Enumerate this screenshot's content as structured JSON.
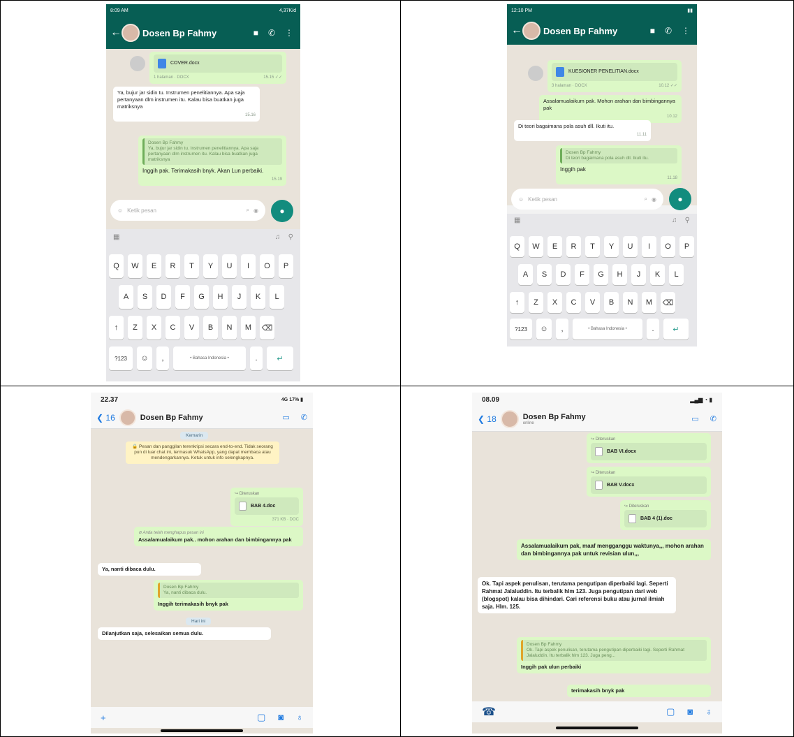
{
  "panel1": {
    "status_time": "8:09 AM",
    "status_right": "4,37K/d",
    "contact": "Dosen Bp Fahmy",
    "doc_name": "COVER.docx",
    "doc_meta": "1 halaman · DOCX",
    "doc_time": "15.15",
    "msg_in": "Ya, bujur jar sidin tu. Instrumen penelitiannya. Apa saja pertanyaan dlm instrumen itu. Kalau bisa buatkan juga matriksnya",
    "msg_in_time": "15.16",
    "quote_name": "Dosen Bp Fahmy",
    "quote_text": "Ya, bujur jar sidin tu. Instrumen penelitiannya. Apa saja pertanyaan dlm instrumen itu. Kalau bisa buatkan juga matriksnya",
    "reply": "Inggih pak. Terimakasih bnyk. Akan Lun perbaiki.",
    "reply_time": "15.19",
    "input_placeholder": "Ketik pesan",
    "keys_row1": [
      "Q",
      "W",
      "E",
      "R",
      "T",
      "Y",
      "U",
      "I",
      "O",
      "P"
    ],
    "keys_row2": [
      "A",
      "S",
      "D",
      "F",
      "G",
      "H",
      "J",
      "K",
      "L"
    ],
    "keys_row3": [
      "↑",
      "Z",
      "X",
      "C",
      "V",
      "B",
      "N",
      "M",
      "⌫"
    ],
    "key_num": "?123",
    "space_label": "• Bahasa Indonesia •",
    "key_emoji": "☺",
    "key_enter": "↵"
  },
  "panel2": {
    "status_time": "12:10 PM",
    "contact": "Dosen Bp Fahmy",
    "doc_name": "KUESIONER PENELITIAN.docx",
    "doc_meta": "3 halaman · DOCX",
    "doc_time": "10.12",
    "msg_out": "Assalamualaikum pak. Mohon arahan dan bimbingannya pak",
    "msg_out_time": "10.12",
    "msg_in": "Di teori bagaimana pola asuh dll. Ikuti itu.",
    "msg_in_time": "11.11",
    "quote_name": "Dosen Bp Fahmy",
    "quote_text": "Di teori bagaimana pola asuh dll. Ikuti itu.",
    "reply": "Inggih pak",
    "reply_time": "11.18",
    "input_placeholder": "Ketik pesan",
    "keys_row1": [
      "Q",
      "W",
      "E",
      "R",
      "T",
      "Y",
      "U",
      "I",
      "O",
      "P"
    ],
    "keys_row2": [
      "A",
      "S",
      "D",
      "F",
      "G",
      "H",
      "J",
      "K",
      "L"
    ],
    "keys_row3": [
      "↑",
      "Z",
      "X",
      "C",
      "V",
      "B",
      "N",
      "M",
      "⌫"
    ],
    "key_num": "?123",
    "space_label": "• Bahasa Indonesia •",
    "key_emoji": "☺",
    "key_enter": "↵"
  },
  "panel3": {
    "status_time": "22.37",
    "status_right": "4G 17% ▮",
    "back_count": "16",
    "contact": "Dosen Bp Fahmy",
    "date_pill": "Kemarin",
    "encryption": "🔒 Pesan dan panggilan terenkripsi secara end-to-end. Tidak seorang pun di luar chat ini, termasuk WhatsApp, yang dapat membaca atau mendengarkannya. Ketuk untuk info selengkapnya.",
    "fwd_label": "↪ Diteruskan",
    "doc_name": "BAB 4.doc",
    "doc_meta": "371 KB · DOC",
    "deleted": "⊘ Anda telah menghapus pesan ini",
    "msg_out": "Assalamualaikum pak.. mohon arahan dan bimbingannya pak",
    "msg_in": "Ya, nanti dibaca dulu.",
    "quote_name": "Dosen Bp Fahmy",
    "quote_text": "Ya, nanti dibaca dulu.",
    "reply": "Inggih terimakasih bnyk pak",
    "today_pill": "Hari ini",
    "msg_in2": "Dilanjutkan saja, selesaikan semua dulu."
  },
  "panel4": {
    "status_time": "08.09",
    "back_count": "18",
    "contact": "Dosen Bp Fahmy",
    "contact_sub": "online",
    "fwd_label": "↪ Diteruskan",
    "doc1": "BAB VI.docx",
    "doc2": "BAB V.docx",
    "doc3": "BAB 4 (1).doc",
    "msg_out": "Assalamualaikum pak, maaf mengganggu waktunya,,, mohon arahan dan bimbingannya pak untuk revisian ulun,,,",
    "msg_in": "Ok. Tapi aspek penulisan, terutama pengutipan diperbaiki lagi. Seperti Rahmat Jalaluddin. Itu terbalik hlm 123. Juga pengutipan dari web (blogspot) kalau bisa dihindari. Cari referensi buku atau jurnal ilmiah saja. Hlm. 125.",
    "quote_name": "Dosen Bp Fahmy",
    "quote_text": "Ok. Tapi aspek penulisan, terutama pengutipan diperbaiki lagi. Seperti Rahmat Jalaluddin. Itu terbalik hlm 123. Juga peng...",
    "reply1": "Inggih pak ulun perbaiki",
    "reply2": "terimakasih bnyk pak"
  }
}
